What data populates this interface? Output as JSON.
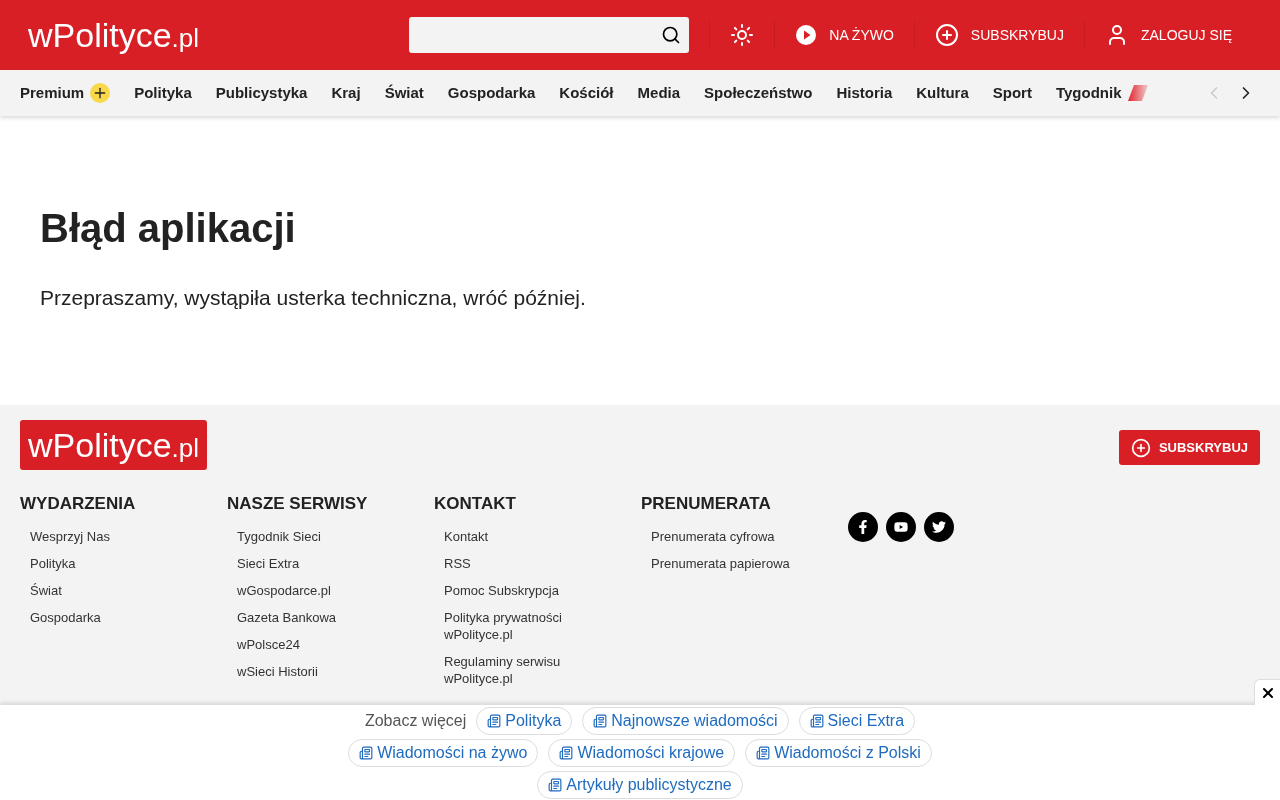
{
  "header": {
    "logo": {
      "name": "wPolityce",
      "suffix": ".pl"
    },
    "actions": [
      {
        "kind": "theme"
      },
      {
        "kind": "live",
        "label": "NA ŻYWO"
      },
      {
        "kind": "subscribe",
        "label": "SUBSKRYBUJ"
      },
      {
        "kind": "login",
        "label": "ZALOGUJ SIĘ"
      }
    ]
  },
  "nav": {
    "items": [
      {
        "label": "Premium",
        "kind": "premium"
      },
      {
        "label": "Polityka",
        "kind": "plain"
      },
      {
        "label": "Publicystyka",
        "kind": "plain"
      },
      {
        "label": "Kraj",
        "kind": "plain"
      },
      {
        "label": "Świat",
        "kind": "plain"
      },
      {
        "label": "Gospodarka",
        "kind": "plain"
      },
      {
        "label": "Kościół",
        "kind": "plain"
      },
      {
        "label": "Media",
        "kind": "plain"
      },
      {
        "label": "Społeczeństwo",
        "kind": "plain"
      },
      {
        "label": "Historia",
        "kind": "plain"
      },
      {
        "label": "Kultura",
        "kind": "plain"
      },
      {
        "label": "Sport",
        "kind": "plain"
      },
      {
        "label": "Tygodnik",
        "kind": "tygodnik"
      }
    ],
    "prev_disabled": true,
    "next_disabled": false
  },
  "error": {
    "title": "Błąd aplikacji",
    "message": "Przepraszamy, wystąpiła usterka techniczna, wróć później."
  },
  "footer": {
    "logo": {
      "name": "wPolityce",
      "suffix": ".pl"
    },
    "subscribe_button": "SUBSKRYBUJ",
    "columns": [
      {
        "heading": "WYDARZENIA",
        "links": [
          "Wesprzyj Nas",
          "Polityka",
          "Świat",
          "Gospodarka"
        ]
      },
      {
        "heading": "NASZE SERWISY",
        "links": [
          "Tygodnik Sieci",
          "Sieci Extra",
          "wGospodarce.pl",
          "Gazeta Bankowa",
          "wPolsce24",
          "wSieci Historii"
        ]
      },
      {
        "heading": "KONTAKT",
        "links": [
          "Kontakt",
          "RSS",
          "Pomoc Subskrypcja",
          "Polityka prywatności wPolityce.pl",
          "Regulaminy serwisu wPolityce.pl"
        ]
      },
      {
        "heading": "PRENUMERATA",
        "links": [
          "Prenumerata cyfrowa",
          "Prenumerata papierowa"
        ]
      }
    ],
    "social": [
      {
        "kind": "facebook"
      },
      {
        "kind": "youtube"
      },
      {
        "kind": "twitter"
      }
    ]
  },
  "see_more": {
    "label": "Zobacz więcej",
    "chips": [
      "Polityka",
      "Najnowsze wiadomości",
      "Sieci Extra",
      "Wiadomości na żywo",
      "Wiadomości krajowe",
      "Wiadomości z Polski",
      "Artykuły publicystyczne"
    ]
  }
}
